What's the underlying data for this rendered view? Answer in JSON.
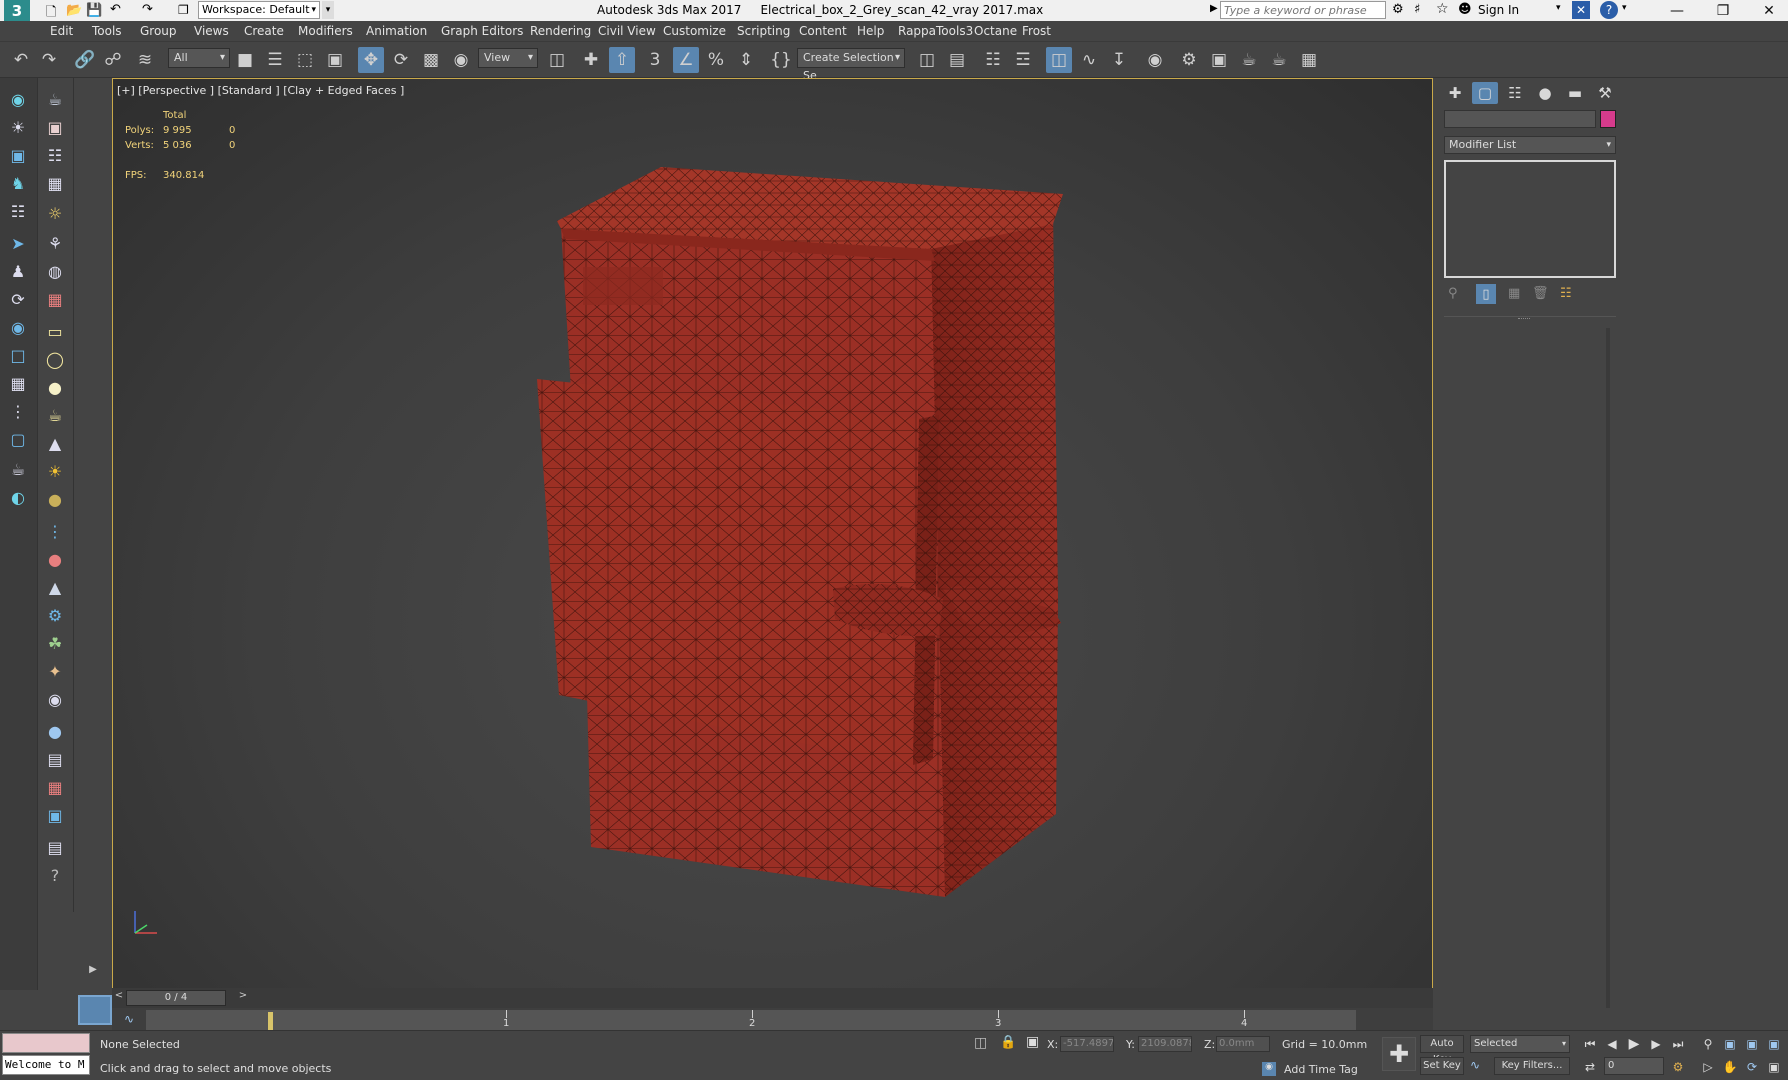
{
  "title": {
    "app_title": "Autodesk 3ds Max 2017",
    "file_name": "Electrical_box_2_Grey_scan_42_vray 2017.max",
    "workspace": "Workspace: Default",
    "search_placeholder": "Type a keyword or phrase",
    "sign_in": "Sign In"
  },
  "menu": {
    "items": [
      "Edit",
      "Tools",
      "Group",
      "Views",
      "Create",
      "Modifiers",
      "Animation",
      "Graph Editors",
      "Rendering",
      "Civil View",
      "Customize",
      "Scripting",
      "Content",
      "Help",
      "RappaTools3",
      "Octane",
      "Frost"
    ]
  },
  "toolbar": {
    "selection_filter": "All",
    "ref_coord": "View",
    "named_selection": "Create Selection Se"
  },
  "viewport": {
    "label": "[+] [Perspective ] [Standard ] [Clay + Edged Faces ]",
    "stats": {
      "total_header": "Total",
      "polys_label": "Polys:",
      "polys_value": "9 995",
      "polys_sel": "0",
      "verts_label": "Verts:",
      "verts_value": "5 036",
      "verts_sel": "0",
      "fps_label": "FPS:",
      "fps_value": "340.814"
    },
    "object_color": "#9b2f25",
    "border_color": "#c9a94a"
  },
  "command_panel": {
    "name_field_value": "",
    "color_swatch": "#d63b8c",
    "modifier_list": "Modifier List"
  },
  "timeline": {
    "frame_counter": "0 / 4",
    "tick_labels": [
      "1",
      "2",
      "3",
      "4"
    ]
  },
  "status": {
    "maxscript_text": "Welcome to M",
    "selection": "None Selected",
    "prompt": "Click and drag to select and move objects",
    "x_label": "X:",
    "x_value": "-517.4897",
    "y_label": "Y:",
    "y_value": "2109.0878",
    "z_label": "Z:",
    "z_value": "0.0mm",
    "grid": "Grid = 10.0mm",
    "add_time_tag": "Add Time Tag",
    "auto_key": "Auto Key",
    "set_key": "Set Key",
    "key_mode": "Selected",
    "key_filters": "Key Filters...",
    "current_frame": "0"
  }
}
